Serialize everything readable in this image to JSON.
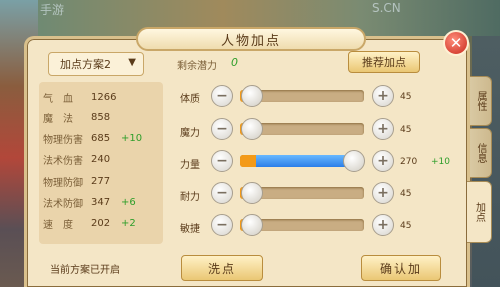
{
  "window": {
    "title": "人物加点",
    "close_label": "✕"
  },
  "watermarks": [
    "手游",
    "S.CN"
  ],
  "scheme": {
    "selected": "加点方案2",
    "note": "当前方案已开启"
  },
  "stats": [
    {
      "name": "气　血",
      "value": "1266",
      "bonus": ""
    },
    {
      "name": "魔　法",
      "value": "858",
      "bonus": ""
    },
    {
      "name": "物理伤害",
      "value": "685",
      "bonus": "+10"
    },
    {
      "name": "法术伤害",
      "value": "240",
      "bonus": ""
    },
    {
      "name": "物理防御",
      "value": "277",
      "bonus": ""
    },
    {
      "name": "法术防御",
      "value": "347",
      "bonus": "+6"
    },
    {
      "name": "速　度",
      "value": "202",
      "bonus": "+2"
    }
  ],
  "potential": {
    "label": "剩余潜力",
    "value": "0"
  },
  "recommend_label": "推荐加点",
  "attributes": [
    {
      "name": "体质",
      "value": "45",
      "bonus": "",
      "level": 0.1
    },
    {
      "name": "魔力",
      "value": "45",
      "bonus": "",
      "level": 0.1
    },
    {
      "name": "力量",
      "value": "270",
      "bonus": "+10",
      "level": 0.92,
      "base_level": 0.13
    },
    {
      "name": "耐力",
      "value": "45",
      "bonus": "",
      "level": 0.1
    },
    {
      "name": "敏捷",
      "value": "45",
      "bonus": "",
      "level": 0.1
    }
  ],
  "buttons": {
    "wash": "洗点",
    "confirm": "确认加"
  },
  "side_tabs": [
    "属性",
    "信息",
    "加点"
  ],
  "colors": {
    "panel": "#f4e6c6",
    "bonus_green": "#2e9e2a",
    "slider_blue": "#2b7ee8",
    "slider_orange": "#f39a18"
  }
}
